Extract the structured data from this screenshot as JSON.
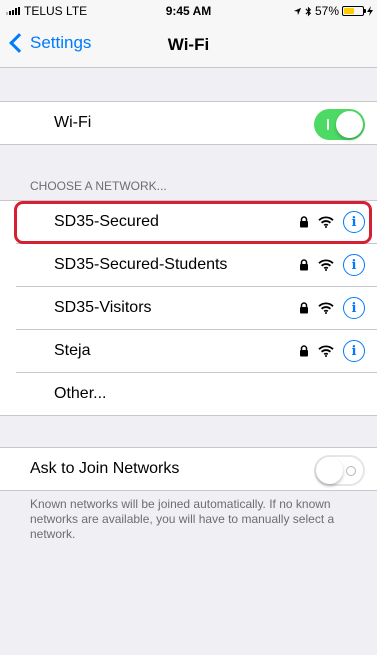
{
  "status_bar": {
    "carrier": "TELUS",
    "network": "LTE",
    "time": "9:45 AM",
    "battery_percent_label": "57%",
    "battery_level": 0.57,
    "battery_color": "#ffcc00"
  },
  "nav": {
    "back_label": "Settings",
    "title": "Wi-Fi"
  },
  "wifi_row": {
    "label": "Wi-Fi",
    "enabled": true
  },
  "networks_section": {
    "header": "CHOOSE A NETWORK...",
    "networks": [
      {
        "name": "SD35-Secured",
        "secured": true,
        "icons": [
          "lock-icon",
          "wifi-icon",
          "info-icon"
        ]
      },
      {
        "name": "SD35-Secured-Students",
        "secured": true,
        "icons": [
          "lock-icon",
          "wifi-icon",
          "info-icon"
        ]
      },
      {
        "name": "SD35-Visitors",
        "secured": true,
        "icons": [
          "lock-icon",
          "wifi-icon",
          "info-icon"
        ]
      },
      {
        "name": "Steja",
        "secured": true,
        "icons": [
          "lock-icon",
          "wifi-icon",
          "info-icon"
        ]
      }
    ],
    "other_label": "Other..."
  },
  "ask_join": {
    "label": "Ask to Join Networks",
    "enabled": false,
    "note": "Known networks will be joined automatically. If no known networks are available, you will have to manually select a network."
  },
  "colors": {
    "accent": "#007aff",
    "toggle_on": "#4cd964",
    "highlight": "#d61f33",
    "background": "#efeff4"
  }
}
